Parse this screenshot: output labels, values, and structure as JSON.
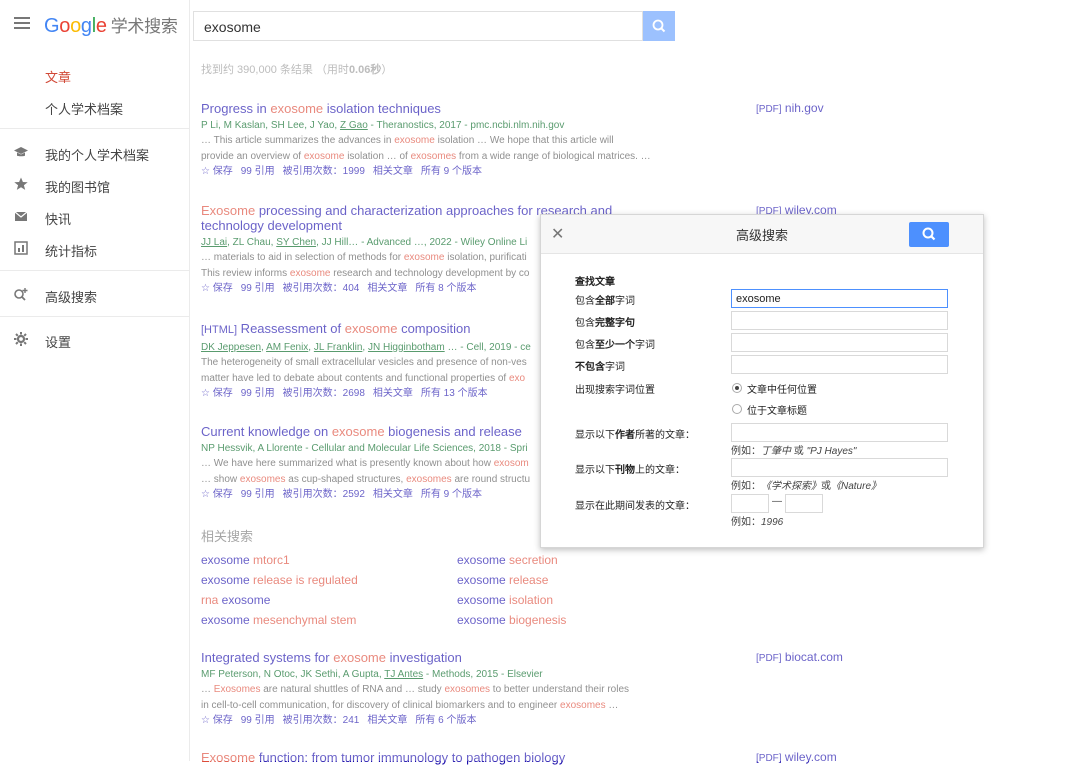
{
  "app": {
    "logo_text": "Google",
    "scholar_text": "学术搜索"
  },
  "search": {
    "query": "exosome",
    "stats_prefix": "找到约 390,000 条结果 （用时",
    "stats_time": "0.06秒",
    "stats_suffix": "）"
  },
  "sidebar": {
    "items": [
      {
        "label": "文章",
        "active": true
      },
      {
        "label": "个人学术档案"
      },
      {
        "label": "我的个人学术档案",
        "icon": "graduation-cap-icon"
      },
      {
        "label": "我的图书馆",
        "icon": "star-icon"
      },
      {
        "label": "快讯",
        "icon": "mail-icon"
      },
      {
        "label": "统计指标",
        "icon": "chart-icon"
      },
      {
        "label": "高级搜索",
        "icon": "advanced-search-icon"
      },
      {
        "label": "设置",
        "icon": "gear-icon"
      }
    ]
  },
  "actions": {
    "save": "☆ 保存",
    "cite": "99 引用",
    "related": "相关文章"
  },
  "results": [
    {
      "title_pre": "Progress in ",
      "title_hl": "exosome",
      "title_post": " isolation techniques",
      "authors": "P Li, M Kaslan, SH Lee, J Yao, ",
      "authors_link": "Z Gao",
      "source": " - Theranostics, 2017 - pmc.ncbi.nlm.nih.gov",
      "snippet1": "… This article summarizes the advances in ",
      "snippet1_hl": "exosome",
      "snippet1_post": " isolation … We hope that this article will",
      "snippet2": "provide an overview of ",
      "snippet2_hl": "exosome",
      "snippet2_mid": " isolation … of ",
      "snippet2_hl2": "exosomes",
      "snippet2_post": " from a wide range of biological matrices. …",
      "cited": "被引用次数：1999",
      "versions": "所有 9 个版本",
      "pdf_tag": "[PDF]",
      "pdf_domain": "nih.gov"
    },
    {
      "title_hl": "Exosome",
      "title_post": " processing and characterization approaches for research and",
      "title_line2": "technology development",
      "authors_link1": "JJ Lai",
      "authors_mid": ", ZL Chau, ",
      "authors_link2": "SY Chen",
      "authors_post": ", JJ Hill… - Advanced …, 2022 - Wiley Online Li",
      "snippet1": "… materials to aid in selection of methods for ",
      "snippet1_hl": "exosome",
      "snippet1_post": " isolation, purificati",
      "snippet2": "This review informs ",
      "snippet2_hl": "exosome",
      "snippet2_post": " research and technology development by co",
      "cited": "被引用次数：404",
      "versions": "所有 8 个版本",
      "pdf_tag": "[PDF]",
      "pdf_domain": "wiley.com"
    },
    {
      "tag": "[HTML]",
      "title_pre": " Reassessment of ",
      "title_hl": "exosome",
      "title_post": " composition",
      "authors_link1": "DK Jeppesen",
      "authors_link2": "AM Fenix",
      "authors_link3": "JL Franklin",
      "authors_link4": "JN Higginbotham",
      "authors_post": " … - Cell, 2019 - ce",
      "snippet1": "The heterogeneity of small extracellular vesicles and presence of non-ves",
      "snippet2": "matter have led to debate about contents and functional properties of ",
      "snippet2_hl": "exo",
      "cited": "被引用次数：2698",
      "versions": "所有 13 个版本"
    },
    {
      "title_pre": "Current knowledge on ",
      "title_hl": "exosome",
      "title_post": " biogenesis and release",
      "authors": "NP Hessvik, A Llorente - Cellular and Molecular Life Sciences, 2018 - Spri",
      "snippet1": "… We have here summarized what is presently known about how ",
      "snippet1_hl": "exosom",
      "snippet2": "… show ",
      "snippet2_hl": "exosomes",
      "snippet2_mid": " as cup-shaped structures, ",
      "snippet2_hl2": "exosomes",
      "snippet2_post": " are round structu",
      "cited": "被引用次数：2592",
      "versions": "所有 9 个版本"
    },
    {
      "title_pre": "Integrated systems for ",
      "title_hl": "exosome",
      "title_post": " investigation",
      "authors": "MF Peterson, N Otoc, JK Sethi, A Gupta, ",
      "authors_link": "TJ Antes",
      "source": " - Methods, 2015 - Elsevier",
      "snippet1": "… ",
      "snippet1_hl": "Exosomes",
      "snippet1_mid": " are natural shuttles of RNA and … study ",
      "snippet1_hl2": "exosomes",
      "snippet1_post": " to better understand their roles",
      "snippet2": "in cell-to-cell communication, for discovery of clinical biomarkers and to engineer ",
      "snippet2_hl": "exosomes",
      "snippet2_post": " …",
      "cited": "被引用次数：241",
      "versions": "所有 6 个版本",
      "pdf_tag": "[PDF]",
      "pdf_domain": "biocat.com"
    },
    {
      "title_hl": "Exosome",
      "title_post": " function: from tumor immunology to pathogen biology",
      "pdf_tag": "[PDF]",
      "pdf_domain": "wiley.com"
    }
  ],
  "related_searches": {
    "heading": "相关搜索",
    "items": [
      {
        "base": "exosome",
        "extra": " mtorc1",
        "base_first": true
      },
      {
        "base": "exosome",
        "extra": " secretion",
        "base_first": true
      },
      {
        "base": "exosome",
        "extra": " release is regulated",
        "base_first": true
      },
      {
        "base": "exosome",
        "extra": " release",
        "base_first": true
      },
      {
        "base": " exosome",
        "extra": "rna",
        "base_first": false
      },
      {
        "base": "exosome",
        "extra": " isolation",
        "base_first": true
      },
      {
        "base": "exosome",
        "extra": " mesenchymal stem",
        "base_first": true
      },
      {
        "base": "exosome",
        "extra": " biogenesis",
        "base_first": true
      }
    ]
  },
  "advanced": {
    "title": "高级搜索",
    "section": "查找文章",
    "all_words_a": "包含",
    "all_words_b": "全部",
    "all_words_c": "字词",
    "all_words_value": "exosome",
    "exact_a": "包含",
    "exact_b": "完整字句",
    "least_a": "包含",
    "least_b": "至少一个",
    "least_c": "字词",
    "without_a": "不包含",
    "without_b": "字词",
    "where": "出现搜索字词位置",
    "where_opt1": "文章中任何位置",
    "where_opt2": "位于文章标题",
    "author_a": "显示以下",
    "author_b": "作者",
    "author_c": "所著的文章：",
    "author_hint_a": "例如：",
    "author_hint_b": "丁肇中",
    "author_hint_c": " 或 ",
    "author_hint_d": "\"PJ Hayes\"",
    "pub_a": "显示以下",
    "pub_b": "刊物",
    "pub_c": "上的文章：",
    "pub_hint_a": "例如：",
    "pub_hint_b": "《学术探索》",
    "pub_hint_c": "或",
    "pub_hint_d": "《Nature》",
    "date": "显示在此期间发表的文章：",
    "date_dash": "—",
    "date_hint_a": "例如：",
    "date_hint_b": "1996"
  },
  "colors": {
    "link": "#1a0dab",
    "highlight": "#dd4b39",
    "author_green": "#006621",
    "search_blue": "#4d90fe"
  }
}
